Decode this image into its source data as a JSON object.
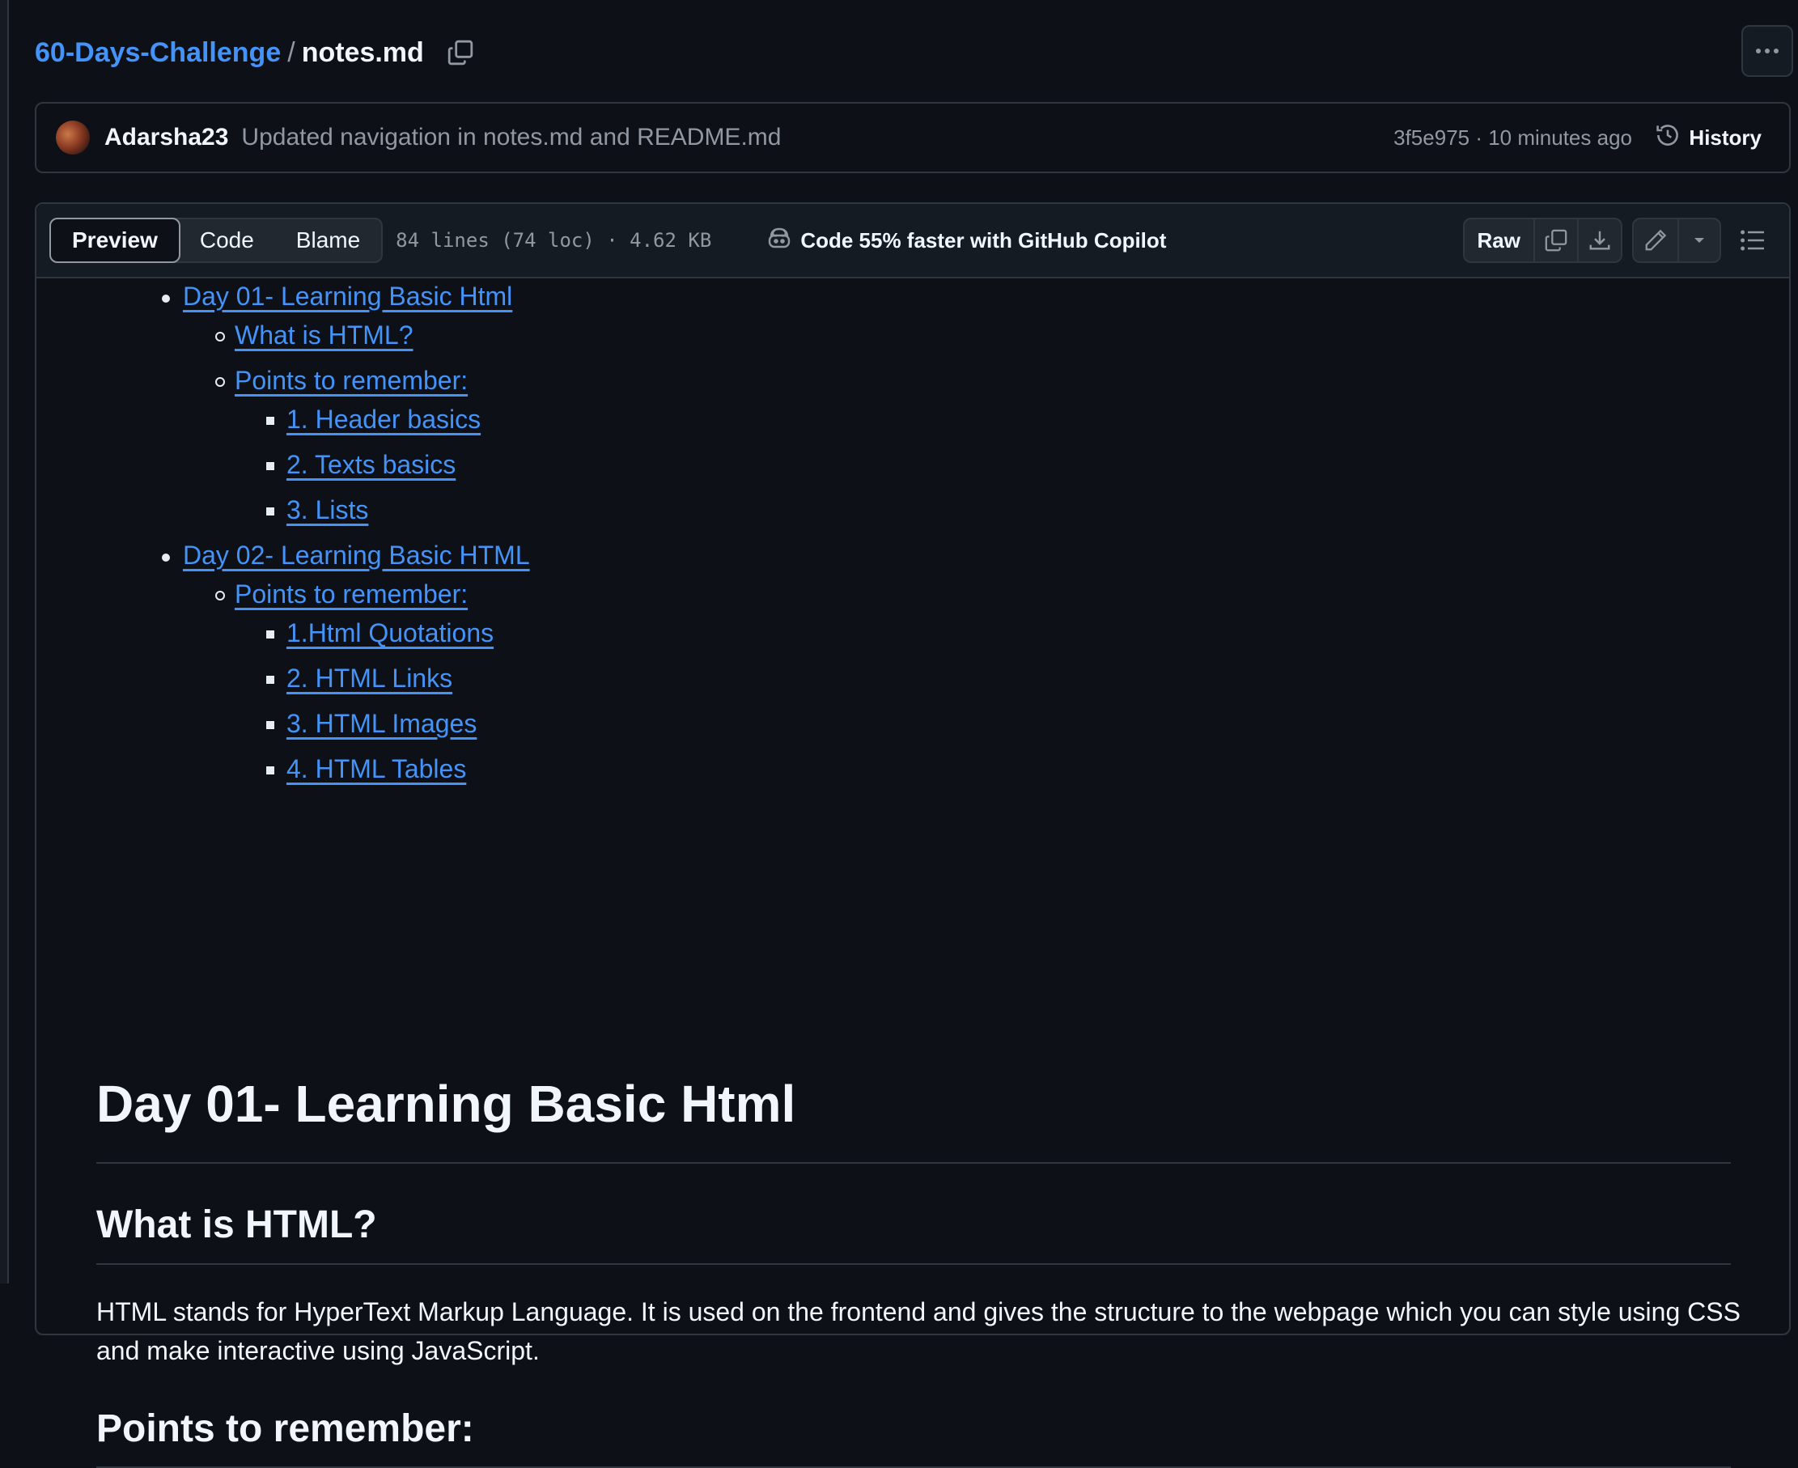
{
  "breadcrumb": {
    "repo": "60-Days-Challenge",
    "separator": "/",
    "file": "notes.md"
  },
  "commit": {
    "author": "Adarsha23",
    "message": "Updated navigation in notes.md and README.md",
    "meta": "3f5e975 · 10 minutes ago",
    "history_label": "History"
  },
  "file_header": {
    "tabs": [
      "Preview",
      "Code",
      "Blame"
    ],
    "active_tab": "Preview",
    "info": "84 lines (74 loc) · 4.62 KB",
    "copilot": "Code 55% faster with GitHub Copilot",
    "raw_label": "Raw"
  },
  "icons": {
    "copy": "copy-icon",
    "more": "kebab-horizontal-icon",
    "history": "history-icon",
    "copilot": "copilot-icon",
    "download": "download-icon",
    "edit": "pencil-icon",
    "dropdown": "triangle-down-icon",
    "outline": "list-unordered-icon"
  },
  "colors": {
    "background": "#0d1117",
    "link": "#4493f8",
    "border": "#30363d",
    "muted": "#9198a1"
  },
  "toc": [
    {
      "label": "Day 01- Learning Basic Html",
      "children": [
        {
          "label": "What is HTML?",
          "children": []
        },
        {
          "label": "Points to remember:",
          "children": [
            {
              "label": "1. Header basics"
            },
            {
              "label": "2. Texts basics"
            },
            {
              "label": "3. Lists"
            }
          ]
        }
      ]
    },
    {
      "label": "Day 02- Learning Basic HTML",
      "children": [
        {
          "label": "Points to remember:",
          "children": [
            {
              "label": "1.Html Quotations"
            },
            {
              "label": "2. HTML Links"
            },
            {
              "label": "3. HTML Images"
            },
            {
              "label": "4. HTML Tables"
            }
          ]
        }
      ]
    }
  ],
  "content": {
    "h1": "Day 01- Learning Basic Html",
    "h2_what": "What is HTML?",
    "paragraph": "HTML stands for HyperText Markup Language. It is used on the frontend and gives the structure to the webpage which you can style using CSS and make interactive using JavaScript.",
    "h2_points": "Points to remember:"
  }
}
